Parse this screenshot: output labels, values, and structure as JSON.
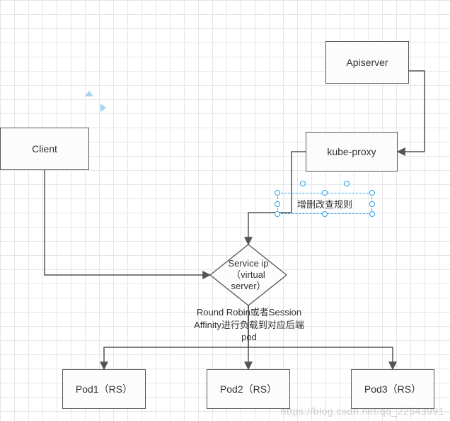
{
  "chart_data": {
    "type": "flowchart",
    "nodes": [
      {
        "id": "apiserver",
        "label": "Apiserver",
        "shape": "rect"
      },
      {
        "id": "client",
        "label": "Client",
        "shape": "rect"
      },
      {
        "id": "kubeproxy",
        "label": "kube-proxy",
        "shape": "rect"
      },
      {
        "id": "service",
        "label": "Service ip\n（virtual\nserver）",
        "shape": "diamond"
      },
      {
        "id": "pod1",
        "label": "Pod1（RS）",
        "shape": "rect"
      },
      {
        "id": "pod2",
        "label": "Pod2（RS）",
        "shape": "rect"
      },
      {
        "id": "pod3",
        "label": "Pod3（RS）",
        "shape": "rect"
      }
    ],
    "edges": [
      {
        "from": "apiserver",
        "to": "kubeproxy"
      },
      {
        "from": "kubeproxy",
        "to": "service",
        "label": "增删改查规则"
      },
      {
        "from": "client",
        "to": "service"
      },
      {
        "from": "service",
        "to": "pod1",
        "label": "Round Robin或者Session Affinity进行负载到对应后端pod"
      },
      {
        "from": "service",
        "to": "pod2"
      },
      {
        "from": "service",
        "to": "pod3"
      }
    ]
  },
  "nodes": {
    "apiserver": {
      "label": "Apiserver"
    },
    "client": {
      "label": "Client"
    },
    "kubeproxy": {
      "label": "kube-proxy"
    },
    "service": {
      "label_l1": "Service ip",
      "label_l2": "（virtual",
      "label_l3": "server）"
    },
    "pod1": {
      "label": "Pod1（RS）"
    },
    "pod2": {
      "label": "Pod2（RS）"
    },
    "pod3": {
      "label": "Pod3（RS）"
    }
  },
  "edge_labels": {
    "rules": "增删改查规则",
    "lb_l1": "Round Robin或者Session",
    "lb_l2": "Affinity进行负载到对应后端",
    "lb_l3": "pod"
  },
  "watermark": "https://blog.csdn.net/qq_22543991"
}
